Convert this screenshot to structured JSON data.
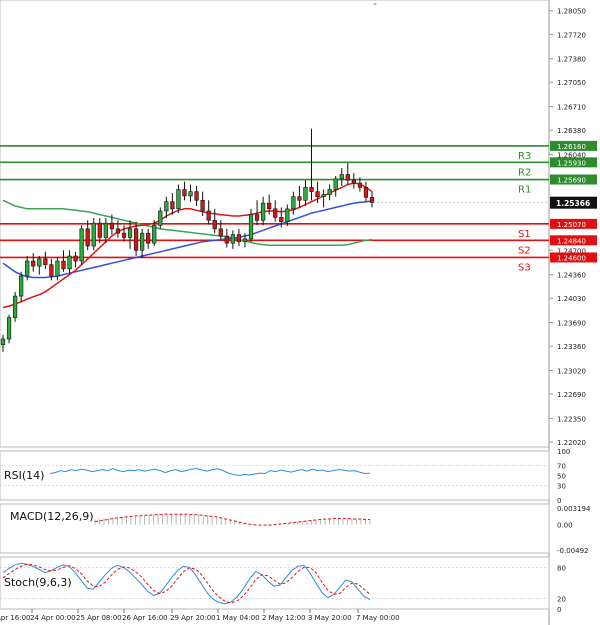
{
  "chart_data": {
    "type": "line",
    "main": {
      "type": "candlestick",
      "y_ticks": [
        "1.28050",
        "1.27720",
        "1.27380",
        "1.27050",
        "1.26710",
        "1.26380",
        "1.26040",
        "1.25366",
        "1.24700",
        "1.24360",
        "1.24030",
        "1.23690",
        "1.23360",
        "1.23020",
        "1.22690",
        "1.22350",
        "1.22020"
      ],
      "current_price": "1.25366",
      "levels": [
        {
          "label": "R3",
          "value": "1.26160",
          "color": "#2e8b2e"
        },
        {
          "label": "R2",
          "value": "1.25930",
          "color": "#2e8b2e"
        },
        {
          "label": "R1",
          "value": "1.25690",
          "color": "#2e8b2e"
        },
        {
          "label": "S1",
          "value": "1.25070",
          "color": "#e01010"
        },
        {
          "label": "S2",
          "value": "1.24840",
          "color": "#e01010"
        },
        {
          "label": "S3",
          "value": "1.24600",
          "color": "#e01010"
        }
      ],
      "candles": [
        [
          1.2338,
          1.2352,
          1.2328,
          1.2346
        ],
        [
          1.2346,
          1.238,
          1.234,
          1.2376
        ],
        [
          1.2376,
          1.2412,
          1.237,
          1.2406
        ],
        [
          1.2406,
          1.244,
          1.2398,
          1.2434
        ],
        [
          1.2434,
          1.2462,
          1.2428,
          1.2455
        ],
        [
          1.2455,
          1.2466,
          1.244,
          1.2448
        ],
        [
          1.2448,
          1.2462,
          1.2436,
          1.2458
        ],
        [
          1.2458,
          1.2468,
          1.2444,
          1.245
        ],
        [
          1.245,
          1.2458,
          1.2428,
          1.2434
        ],
        [
          1.2434,
          1.246,
          1.2428,
          1.2455
        ],
        [
          1.2455,
          1.247,
          1.244,
          1.2444
        ],
        [
          1.2444,
          1.247,
          1.2438,
          1.2462
        ],
        [
          1.2462,
          1.2468,
          1.2446,
          1.2455
        ],
        [
          1.2455,
          1.2505,
          1.245,
          1.25
        ],
        [
          1.25,
          1.2512,
          1.247,
          1.2476
        ],
        [
          1.2476,
          1.2515,
          1.247,
          1.2508
        ],
        [
          1.2508,
          1.2515,
          1.248,
          1.2488
        ],
        [
          1.2488,
          1.2515,
          1.248,
          1.2508
        ],
        [
          1.2508,
          1.252,
          1.2492,
          1.25
        ],
        [
          1.25,
          1.2512,
          1.2488,
          1.2494
        ],
        [
          1.2494,
          1.2505,
          1.2482,
          1.2488
        ],
        [
          1.2488,
          1.2512,
          1.2472,
          1.25
        ],
        [
          1.25,
          1.251,
          1.2462,
          1.247
        ],
        [
          1.247,
          1.25,
          1.246,
          1.2494
        ],
        [
          1.2494,
          1.25,
          1.2472,
          1.248
        ],
        [
          1.248,
          1.2512,
          1.2476,
          1.2505
        ],
        [
          1.2505,
          1.253,
          1.25,
          1.2525
        ],
        [
          1.2525,
          1.2545,
          1.2515,
          1.2538
        ],
        [
          1.2538,
          1.255,
          1.252,
          1.2528
        ],
        [
          1.2528,
          1.2562,
          1.2522,
          1.2555
        ],
        [
          1.2555,
          1.2566,
          1.254,
          1.2546
        ],
        [
          1.2546,
          1.2562,
          1.2538,
          1.2552
        ],
        [
          1.2552,
          1.256,
          1.2532,
          1.254
        ],
        [
          1.254,
          1.2552,
          1.2518,
          1.2525
        ],
        [
          1.2525,
          1.254,
          1.2506,
          1.2512
        ],
        [
          1.2512,
          1.2528,
          1.2494,
          1.25
        ],
        [
          1.25,
          1.2512,
          1.2485,
          1.249
        ],
        [
          1.249,
          1.25,
          1.2474,
          1.248
        ],
        [
          1.248,
          1.2498,
          1.2472,
          1.2492
        ],
        [
          1.2492,
          1.25,
          1.2476,
          1.2482
        ],
        [
          1.2482,
          1.2494,
          1.2474,
          1.2486
        ],
        [
          1.2486,
          1.2528,
          1.2482,
          1.252
        ],
        [
          1.252,
          1.254,
          1.2505,
          1.2512
        ],
        [
          1.2512,
          1.2545,
          1.2505,
          1.2536
        ],
        [
          1.2536,
          1.2548,
          1.252,
          1.2528
        ],
        [
          1.2528,
          1.254,
          1.251,
          1.2516
        ],
        [
          1.2516,
          1.253,
          1.2502,
          1.251
        ],
        [
          1.251,
          1.2534,
          1.2504,
          1.2528
        ],
        [
          1.2528,
          1.2552,
          1.252,
          1.2545
        ],
        [
          1.2545,
          1.256,
          1.253,
          1.254
        ],
        [
          1.254,
          1.2568,
          1.2532,
          1.2558
        ],
        [
          1.2558,
          1.264,
          1.254,
          1.2552
        ],
        [
          1.2552,
          1.2566,
          1.2536,
          1.2545
        ],
        [
          1.2545,
          1.2555,
          1.253,
          1.2548
        ],
        [
          1.2548,
          1.2562,
          1.254,
          1.2555
        ],
        [
          1.2555,
          1.2574,
          1.2545,
          1.257
        ],
        [
          1.257,
          1.2585,
          1.256,
          1.2576
        ],
        [
          1.2576,
          1.2592,
          1.2562,
          1.2568
        ],
        [
          1.2568,
          1.2578,
          1.2556,
          1.2564
        ],
        [
          1.2564,
          1.2572,
          1.2552,
          1.2558
        ],
        [
          1.2558,
          1.2566,
          1.2538,
          1.2544
        ],
        [
          1.2544,
          1.2552,
          1.253,
          1.2537
        ]
      ],
      "ma_red": [
        1.239,
        1.2392,
        1.2395,
        1.2398,
        1.2402,
        1.2405,
        1.2408,
        1.2412,
        1.2418,
        1.2424,
        1.243,
        1.2436,
        1.2442,
        1.245,
        1.2458,
        1.2466,
        1.2474,
        1.2482,
        1.249,
        1.2496,
        1.25,
        1.2502,
        1.2504,
        1.2505,
        1.2506,
        1.2508,
        1.2512,
        1.2518,
        1.2522,
        1.2526,
        1.2528,
        1.2528,
        1.2526,
        1.2524,
        1.2522,
        1.2521,
        1.252,
        1.2519,
        1.2518,
        1.2518,
        1.2519,
        1.252,
        1.2522,
        1.2524,
        1.2525,
        1.2525,
        1.2524,
        1.2525,
        1.2527,
        1.253,
        1.2534,
        1.2538,
        1.2542,
        1.2546,
        1.255,
        1.2554,
        1.2558,
        1.2562,
        1.2564,
        1.2563,
        1.2558,
        1.2552
      ],
      "ma_blue": [
        1.2452,
        1.2446,
        1.244,
        1.2436,
        1.2433,
        1.2432,
        1.2432,
        1.2432,
        1.2433,
        1.2434,
        1.2436,
        1.2438,
        1.244,
        1.2442,
        1.2444,
        1.2446,
        1.2448,
        1.245,
        1.2452,
        1.2454,
        1.2456,
        1.2458,
        1.246,
        1.2462,
        1.2464,
        1.2466,
        1.2468,
        1.247,
        1.2472,
        1.2474,
        1.2476,
        1.2478,
        1.248,
        1.2482,
        1.2483,
        1.2484,
        1.2485,
        1.2486,
        1.2487,
        1.2488,
        1.249,
        1.2492,
        1.2495,
        1.2498,
        1.2501,
        1.2504,
        1.2507,
        1.251,
        1.2513,
        1.2516,
        1.2519,
        1.2522,
        1.2524,
        1.2526,
        1.2528,
        1.253,
        1.2532,
        1.2534,
        1.2536,
        1.2537,
        1.2538,
        1.2539
      ],
      "ma_green": [
        1.254,
        1.2536,
        1.2532,
        1.253,
        1.2528,
        1.2528,
        1.2528,
        1.2528,
        1.2528,
        1.2528,
        1.2528,
        1.2527,
        1.2526,
        1.2525,
        1.2524,
        1.2522,
        1.252,
        1.2518,
        1.2516,
        1.2514,
        1.2512,
        1.251,
        1.2508,
        1.2506,
        1.2504,
        1.2502,
        1.25,
        1.2499,
        1.2498,
        1.2497,
        1.2496,
        1.2495,
        1.2494,
        1.2493,
        1.2492,
        1.2491,
        1.249,
        1.2489,
        1.2487,
        1.2485,
        1.2483,
        1.2481,
        1.2479,
        1.2478,
        1.2477,
        1.2477,
        1.2477,
        1.2477,
        1.2477,
        1.2477,
        1.2477,
        1.2477,
        1.2477,
        1.2477,
        1.2477,
        1.2477,
        1.2477,
        1.2478,
        1.248,
        1.2482,
        1.2484,
        1.2485
      ]
    },
    "rsi": {
      "label": "RSI(14)",
      "y_ticks": [
        "100",
        "70",
        "50",
        "30",
        "0"
      ],
      "values": [
        54,
        56,
        60,
        58,
        62,
        60,
        63,
        61,
        58,
        60,
        62,
        60,
        64,
        60,
        58,
        61,
        60,
        62,
        59,
        61,
        63,
        60,
        56,
        60,
        62,
        58,
        60,
        63,
        64,
        61,
        59,
        62,
        64,
        60,
        55,
        52,
        50,
        52,
        51,
        53,
        55,
        54,
        60,
        58,
        61,
        59,
        57,
        60,
        62,
        59,
        63,
        60,
        61,
        58,
        60,
        62,
        61,
        59,
        60,
        57,
        54,
        55
      ]
    },
    "macd": {
      "label": "MACD(12,26,9)",
      "y_ticks": [
        "0.003194",
        "0.00",
        "-0.00492"
      ],
      "histogram": [
        0.001,
        0.0011,
        0.0012,
        0.0013,
        0.0014,
        0.0015,
        0.0016,
        0.0016,
        0.0017,
        0.0017,
        0.0018,
        0.0018,
        0.0019,
        0.0019,
        0.002,
        0.002,
        0.002,
        0.0021,
        0.0021,
        0.0021,
        0.0021,
        0.002,
        0.002,
        0.0019,
        0.0018,
        0.0017,
        0.0016,
        0.0015,
        0.0013,
        0.0011,
        0.0009,
        0.0007,
        0.0005,
        0.0003,
        0.0002,
        0.0001,
        0.0,
        0.0,
        0.0001,
        0.0001,
        0.0002,
        0.0003,
        0.0003,
        0.0004,
        0.0005,
        0.0006,
        0.0007,
        0.0008,
        0.0009,
        0.001,
        0.0011,
        0.0012,
        0.0012,
        0.0013,
        0.0013,
        0.0012,
        0.0012,
        0.0011,
        0.0011,
        0.001,
        0.001,
        0.001
      ],
      "signal": [
        0.0006,
        0.0007,
        0.0009,
        0.001,
        0.0012,
        0.0013,
        0.0014,
        0.0015,
        0.0016,
        0.0017,
        0.0017,
        0.0018,
        0.0018,
        0.0019,
        0.0019,
        0.002,
        0.002,
        0.002,
        0.002,
        0.002,
        0.002,
        0.002,
        0.0019,
        0.0019,
        0.0018,
        0.0017,
        0.0016,
        0.0015,
        0.0013,
        0.0011,
        0.0009,
        0.0007,
        0.0005,
        0.0003,
        0.0001,
        0.0,
        -0.0001,
        -0.0001,
        -0.0001,
        -0.0001,
        0.0,
        0.0001,
        0.0002,
        0.0003,
        0.0004,
        0.0005,
        0.0006,
        0.0007,
        0.0008,
        0.0009,
        0.001,
        0.0011,
        0.0011,
        0.0012,
        0.0012,
        0.0012,
        0.0012,
        0.0011,
        0.0011,
        0.0011,
        0.001,
        0.001
      ]
    },
    "stoch": {
      "label": "Stoch(9,6,3)",
      "y_ticks": [
        "80",
        "20",
        "0"
      ],
      "k": [
        70,
        78,
        85,
        88,
        86,
        82,
        76,
        70,
        74,
        80,
        85,
        82,
        70,
        55,
        40,
        38,
        52,
        66,
        78,
        84,
        80,
        72,
        60,
        48,
        34,
        26,
        30,
        44,
        60,
        74,
        82,
        80,
        66,
        48,
        30,
        18,
        12,
        10,
        14,
        24,
        40,
        58,
        72,
        66,
        54,
        44,
        46,
        60,
        74,
        82,
        84,
        70,
        50,
        32,
        22,
        28,
        42,
        56,
        52,
        38,
        24,
        18
      ],
      "d": [
        60,
        68,
        76,
        82,
        86,
        85,
        81,
        76,
        73,
        75,
        80,
        83,
        78,
        68,
        54,
        44,
        43,
        52,
        65,
        76,
        81,
        79,
        72,
        62,
        48,
        36,
        30,
        33,
        44,
        58,
        72,
        79,
        77,
        66,
        50,
        34,
        22,
        14,
        12,
        16,
        26,
        40,
        56,
        66,
        64,
        56,
        48,
        50,
        60,
        72,
        80,
        80,
        70,
        52,
        36,
        28,
        30,
        42,
        50,
        48,
        38,
        28
      ]
    },
    "x_ticks": [
      "Apr 16:00",
      "24 Apr 00:00",
      "25 Apr 08:00",
      "26 Apr 16:00",
      "29 Apr 20:00",
      "1 May 04:00",
      "2 May 12:00",
      "3 May 20:00",
      "7 May 00:00"
    ]
  }
}
